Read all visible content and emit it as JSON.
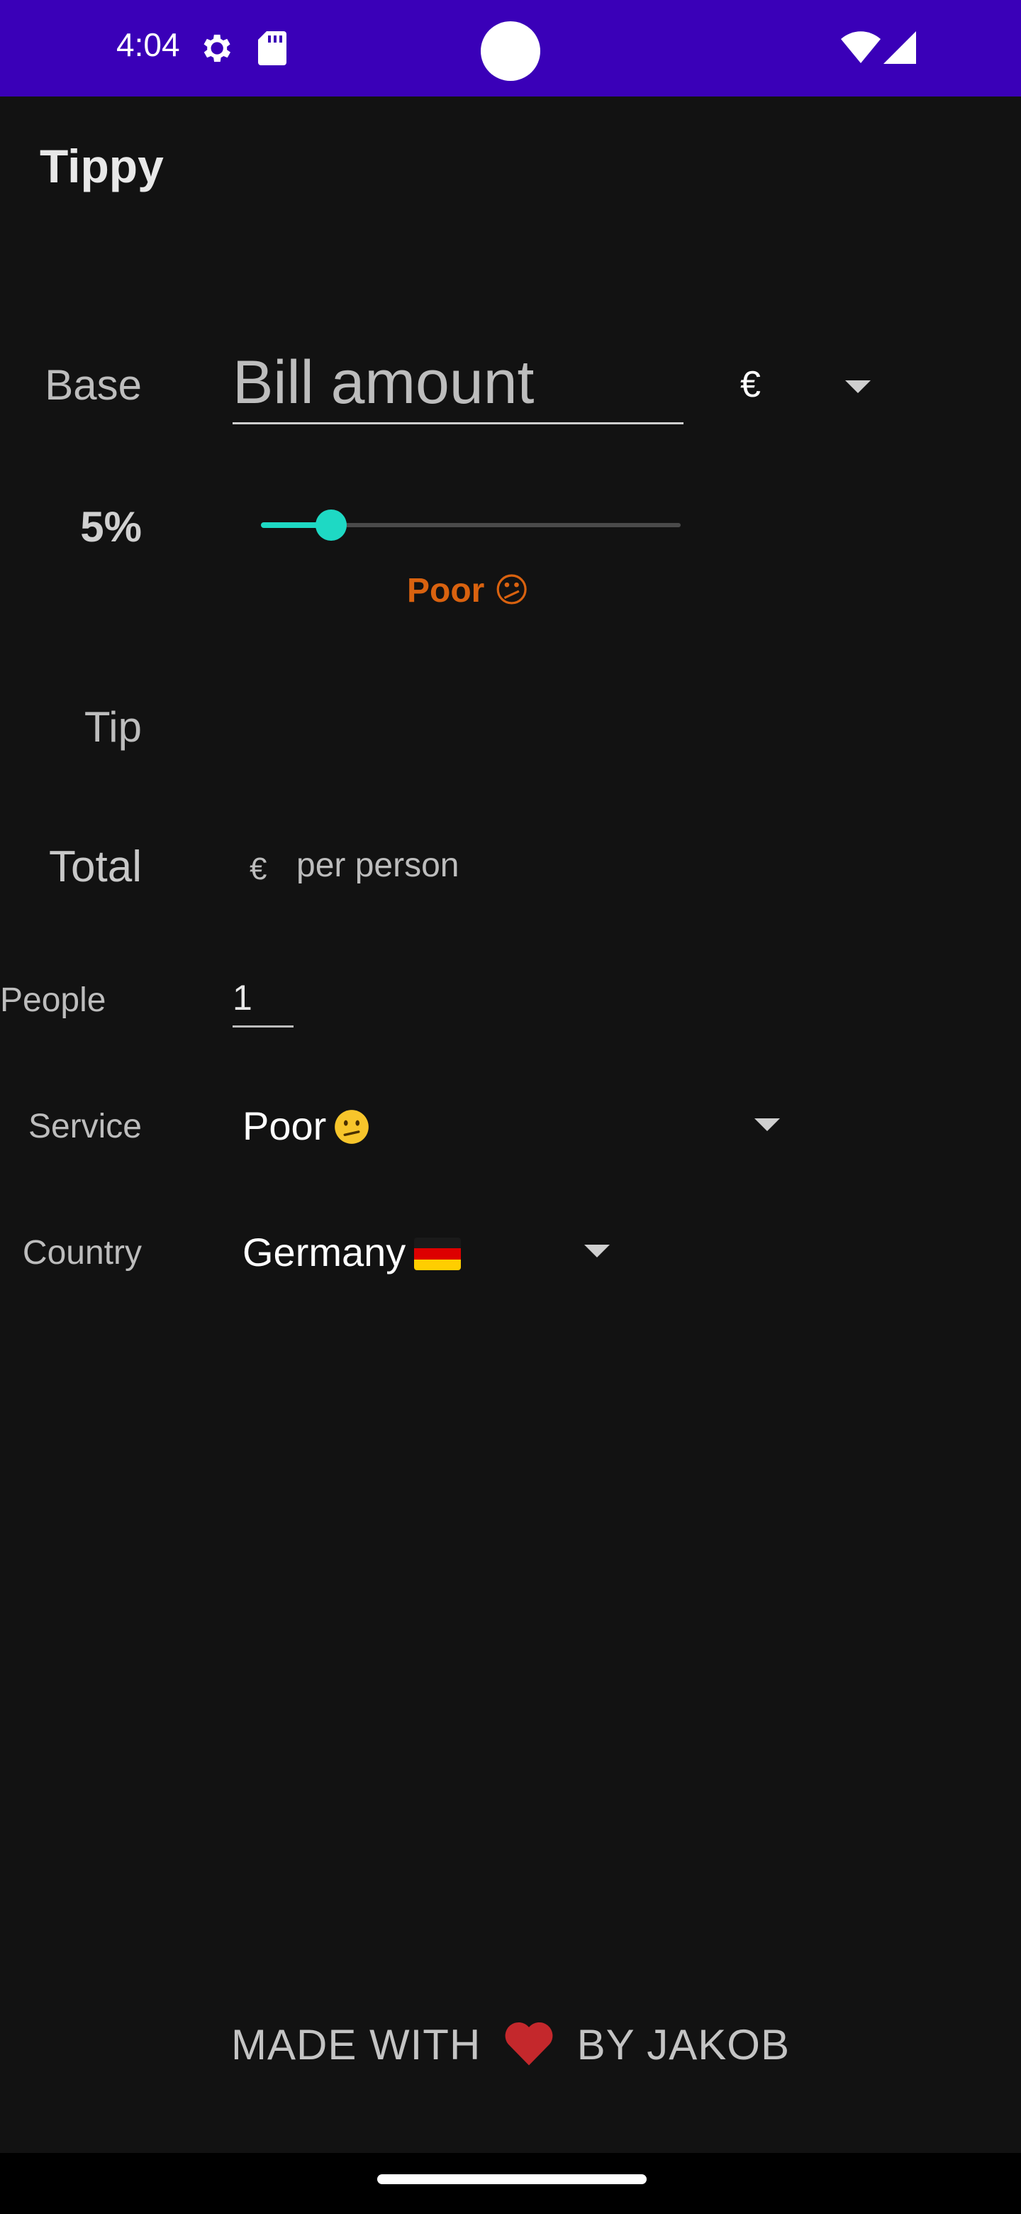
{
  "status_bar": {
    "time": "4:04",
    "icons": [
      "settings-gear-icon",
      "sd-card-icon",
      "wifi-icon",
      "cell-signal-icon"
    ]
  },
  "app": {
    "title": "Tippy"
  },
  "base": {
    "label": "Base",
    "bill_placeholder": "Bill amount",
    "bill_value": "",
    "currency": "€"
  },
  "tip_percent": {
    "label": "5%",
    "value": 5,
    "slider_max": 30,
    "quality": "Poor 😕",
    "quality_color": "#d9620f"
  },
  "tip": {
    "label": "Tip",
    "amount": ""
  },
  "total": {
    "label": "Total",
    "currency": "€",
    "per_person": "per person"
  },
  "people": {
    "label": "People",
    "value": "1"
  },
  "service": {
    "label": "Service",
    "selected": "Poor"
  },
  "country": {
    "label": "Country",
    "selected": "Germany"
  },
  "footer": {
    "prefix": "MADE WITH",
    "suffix": "BY JAKOB"
  },
  "colors": {
    "status_bar": "#3a00b8",
    "background": "#121212",
    "accent": "#1ed9c4",
    "poor_orange": "#d9620f"
  }
}
